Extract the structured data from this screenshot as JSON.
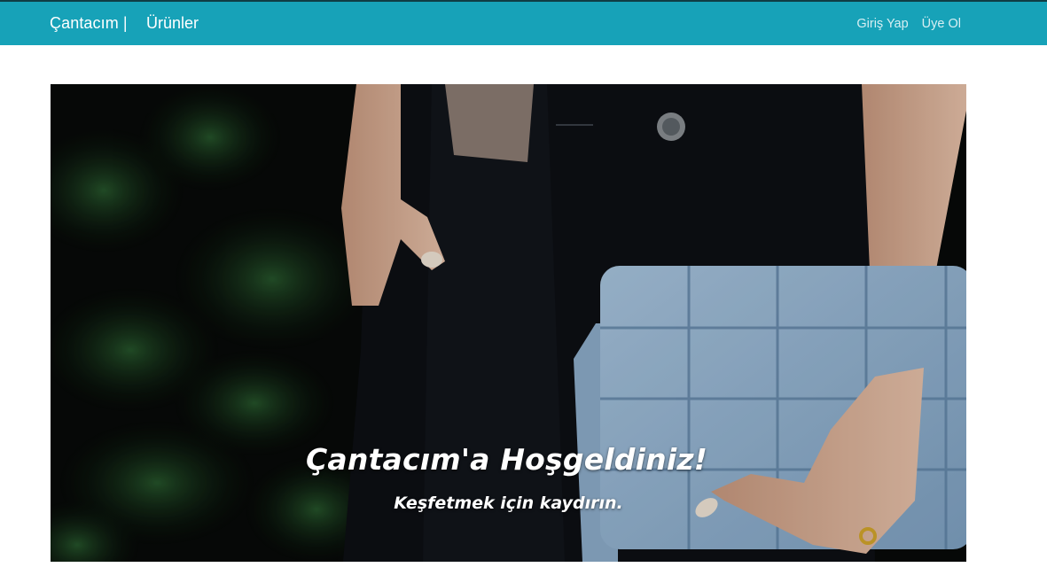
{
  "navbar": {
    "brand": "Çantacım |",
    "products": "Ürünler",
    "login": "Giriş Yap",
    "register": "Üye Ol",
    "background_color": "#17a2b8"
  },
  "hero": {
    "image_alt": "Woman holding a light blue woven leather handbag",
    "title": "Çantacım'a Hoşgeldiniz!",
    "subtitle": "Keşfetmek için kaydırın."
  }
}
